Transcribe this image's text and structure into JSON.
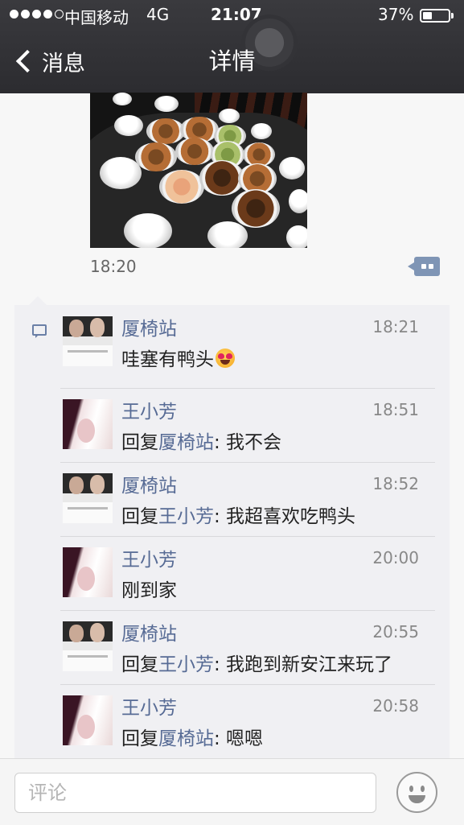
{
  "status_bar": {
    "carrier": "中国移动",
    "network": "4G",
    "time": "21:07",
    "battery_percent": "37%",
    "battery_level": 0.37,
    "signal_bars": 4,
    "signal_max": 5
  },
  "nav": {
    "back_label": "消息",
    "title": "详情"
  },
  "post": {
    "time": "18:20"
  },
  "comments": [
    {
      "name": "厦椅站",
      "time": "18:21",
      "text": "哇塞有鸭头",
      "emoji": "heart-eyes-emoji",
      "avatar": "couple-photo"
    },
    {
      "name": "王小芳",
      "time": "18:51",
      "reply_prefix": "回复",
      "reply_to": "厦椅站",
      "text": ": 我不会",
      "avatar": "pink-photo"
    },
    {
      "name": "厦椅站",
      "time": "18:52",
      "reply_prefix": "回复",
      "reply_to": "王小芳",
      "text": ": 我超喜欢吃鸭头",
      "avatar": "couple-photo"
    },
    {
      "name": "王小芳",
      "time": "20:00",
      "text": "刚到家",
      "avatar": "pink-photo"
    },
    {
      "name": "厦椅站",
      "time": "20:55",
      "reply_prefix": "回复",
      "reply_to": "王小芳",
      "text": ": 我跑到新安江来玩了",
      "avatar": "couple-photo"
    },
    {
      "name": "王小芳",
      "time": "20:58",
      "reply_prefix": "回复",
      "reply_to": "厦椅站",
      "text": ": 嗯嗯",
      "avatar": "pink-photo"
    }
  ],
  "input": {
    "placeholder": "评论"
  },
  "colors": {
    "link_blue": "#576b95",
    "nav_bg": "#2c2c30",
    "panel_bg": "#f0f0f3"
  }
}
